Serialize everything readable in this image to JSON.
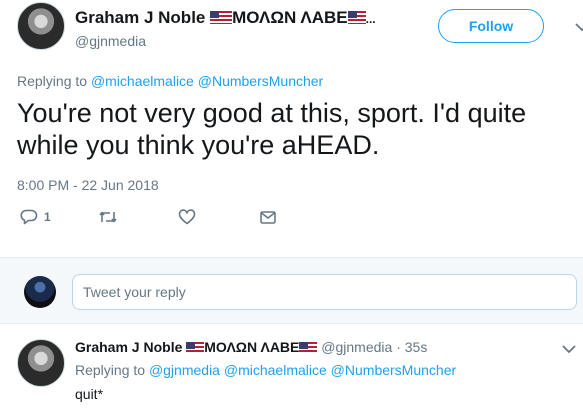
{
  "tweet": {
    "display_name": "Graham J Noble",
    "name_suffix": "ΜΟΛΩΝ ΛΑΒΕ",
    "name_ellipsis": "...",
    "handle": "@gjnmedia",
    "follow_label": "Follow",
    "replying_prefix": "Replying to",
    "replying_to": [
      "@michaelmalice",
      "@NumbersMuncher"
    ],
    "text": "You're not very good at this, sport. I'd quite while you think you're aHEAD.",
    "timestamp": "8:00 PM - 22 Jun 2018",
    "reply_count": "1",
    "icons": [
      "reply-icon",
      "retweet-icon",
      "like-icon",
      "message-icon",
      "chevron-down-icon"
    ]
  },
  "composer": {
    "placeholder": "Tweet your reply"
  },
  "reply": {
    "display_name": "Graham J Noble",
    "name_suffix": "ΜΟΛΩΝ ΛΑΒΕ",
    "handle": "@gjnmedia",
    "time": "· 35s",
    "replying_prefix": "Replying to",
    "replying_to": [
      "@gjnmedia",
      "@michaelmalice",
      "@NumbersMuncher"
    ],
    "text": "quit*"
  },
  "colors": {
    "accent": "#1da1f2",
    "muted": "#657786",
    "text": "#14171a",
    "composer_bg": "#f5f8fa"
  }
}
